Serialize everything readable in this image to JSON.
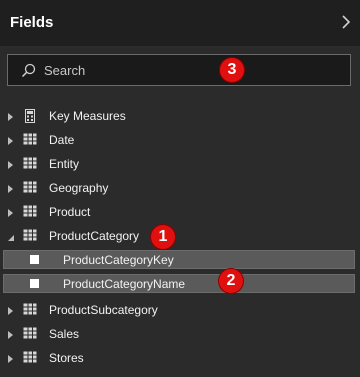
{
  "header": {
    "title": "Fields"
  },
  "search": {
    "placeholder": "Search"
  },
  "tables": [
    {
      "label": "Key Measures",
      "icon": "calculator-icon",
      "state": "collapsed"
    },
    {
      "label": "Date",
      "icon": "table-icon",
      "state": "collapsed"
    },
    {
      "label": "Entity",
      "icon": "table-icon",
      "state": "collapsed"
    },
    {
      "label": "Geography",
      "icon": "table-icon",
      "state": "collapsed"
    },
    {
      "label": "Product",
      "icon": "table-icon",
      "state": "collapsed"
    },
    {
      "label": "ProductCategory",
      "icon": "table-icon",
      "state": "expanded",
      "fields": [
        {
          "label": "ProductCategoryKey",
          "checked": false
        },
        {
          "label": "ProductCategoryName",
          "checked": false
        }
      ]
    },
    {
      "label": "ProductSubcategory",
      "icon": "table-icon",
      "state": "collapsed"
    },
    {
      "label": "Sales",
      "icon": "table-icon",
      "state": "collapsed"
    },
    {
      "label": "Stores",
      "icon": "table-icon",
      "state": "collapsed"
    }
  ],
  "callouts": [
    "1",
    "2",
    "3"
  ],
  "colors": {
    "panel": "#2b2b2b",
    "header": "#1f1f1f",
    "selected_row": "#5a5a5a",
    "callout": "#e01010"
  }
}
